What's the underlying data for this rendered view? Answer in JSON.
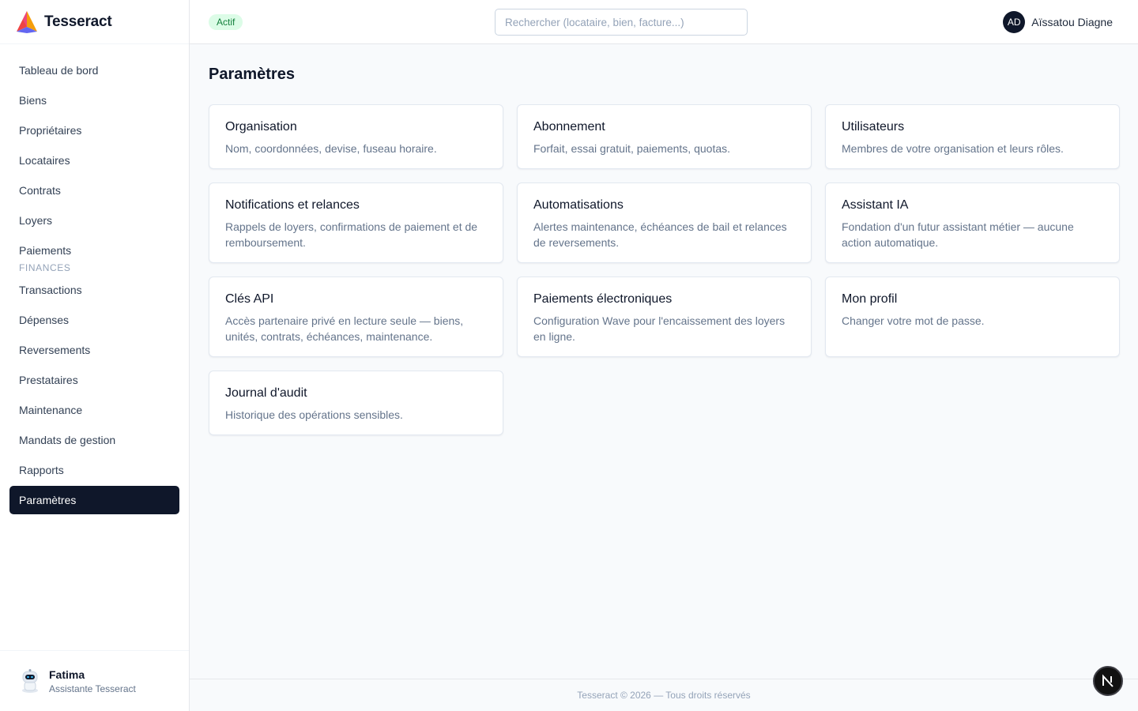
{
  "brand": {
    "name": "Tesseract",
    "logo_icon": "tesseract-logo-icon"
  },
  "sidebar": {
    "items": [
      {
        "label": "Tableau de bord"
      },
      {
        "label": "Biens"
      },
      {
        "label": "Propriétaires"
      },
      {
        "label": "Locataires"
      },
      {
        "label": "Contrats"
      },
      {
        "label": "Loyers"
      },
      {
        "label": "Paiements"
      }
    ],
    "section_finances": "FINANCES",
    "finance_items": [
      {
        "label": "Transactions"
      },
      {
        "label": "Dépenses"
      },
      {
        "label": "Reversements"
      },
      {
        "label": "Prestataires"
      },
      {
        "label": "Maintenance"
      },
      {
        "label": "Mandats de gestion"
      },
      {
        "label": "Rapports"
      },
      {
        "label": "Paramètres",
        "active": true
      }
    ],
    "assistant": {
      "name": "Fatima",
      "role": "Assistante Tesseract",
      "icon": "robot-avatar-icon"
    }
  },
  "header": {
    "status_badge": "Actif",
    "search_placeholder": "Rechercher (locataire, bien, facture...)",
    "user": {
      "initials": "AD",
      "name": "Aïssatou Diagne"
    }
  },
  "main": {
    "title": "Paramètres",
    "cards": [
      {
        "title": "Organisation",
        "desc": "Nom, coordonnées, devise, fuseau horaire."
      },
      {
        "title": "Abonnement",
        "desc": "Forfait, essai gratuit, paiements, quotas."
      },
      {
        "title": "Utilisateurs",
        "desc": "Membres de votre organisation et leurs rôles."
      },
      {
        "title": "Notifications et relances",
        "desc": "Rappels de loyers, confirmations de paiement et de remboursement."
      },
      {
        "title": "Automatisations",
        "desc": "Alertes maintenance, échéances de bail et relances de reversements."
      },
      {
        "title": "Assistant IA",
        "desc": "Fondation d'un futur assistant métier — aucune action automatique."
      },
      {
        "title": "Clés API",
        "desc": "Accès partenaire privé en lecture seule — biens, unités, contrats, échéances, maintenance."
      },
      {
        "title": "Paiements électroniques",
        "desc": "Configuration Wave pour l'encaissement des loyers en ligne."
      },
      {
        "title": "Mon profil",
        "desc": "Changer votre mot de passe."
      },
      {
        "title": "Journal d'audit",
        "desc": "Historique des opérations sensibles."
      }
    ]
  },
  "footer": {
    "text": "Tesseract © 2026 — Tous droits réservés"
  },
  "fab": {
    "label": "N"
  },
  "colors": {
    "primary": "#0f172a",
    "badge_bg": "#dcfce7",
    "badge_text": "#15803d",
    "background": "#f8fafc"
  }
}
